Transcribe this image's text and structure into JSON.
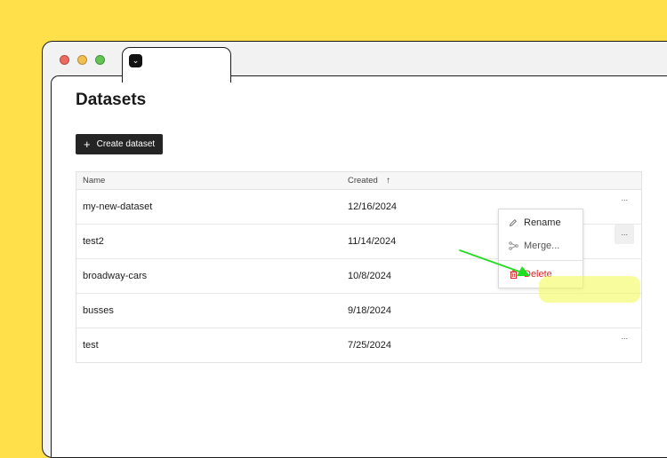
{
  "colors": {
    "background": "#FFE04B",
    "button_bg": "#242424",
    "delete": "#D42E2E",
    "highlight": "#F5FA5A",
    "arrow": "#22DD22"
  },
  "page": {
    "title": "Datasets",
    "create_button": "Create dataset"
  },
  "table": {
    "columns": {
      "name": "Name",
      "created": "Created"
    },
    "sort_icon": "arrow-up-icon",
    "rows": [
      {
        "name": "my-new-dataset",
        "created": "12/16/2024"
      },
      {
        "name": "test2",
        "created": "11/14/2024"
      },
      {
        "name": "broadway-cars",
        "created": "10/8/2024"
      },
      {
        "name": "busses",
        "created": "9/18/2024"
      },
      {
        "name": "test",
        "created": "7/25/2024"
      }
    ],
    "row_menu_label": "···"
  },
  "menu": {
    "rename": "Rename",
    "merge": "Merge...",
    "delete": "Delete"
  }
}
